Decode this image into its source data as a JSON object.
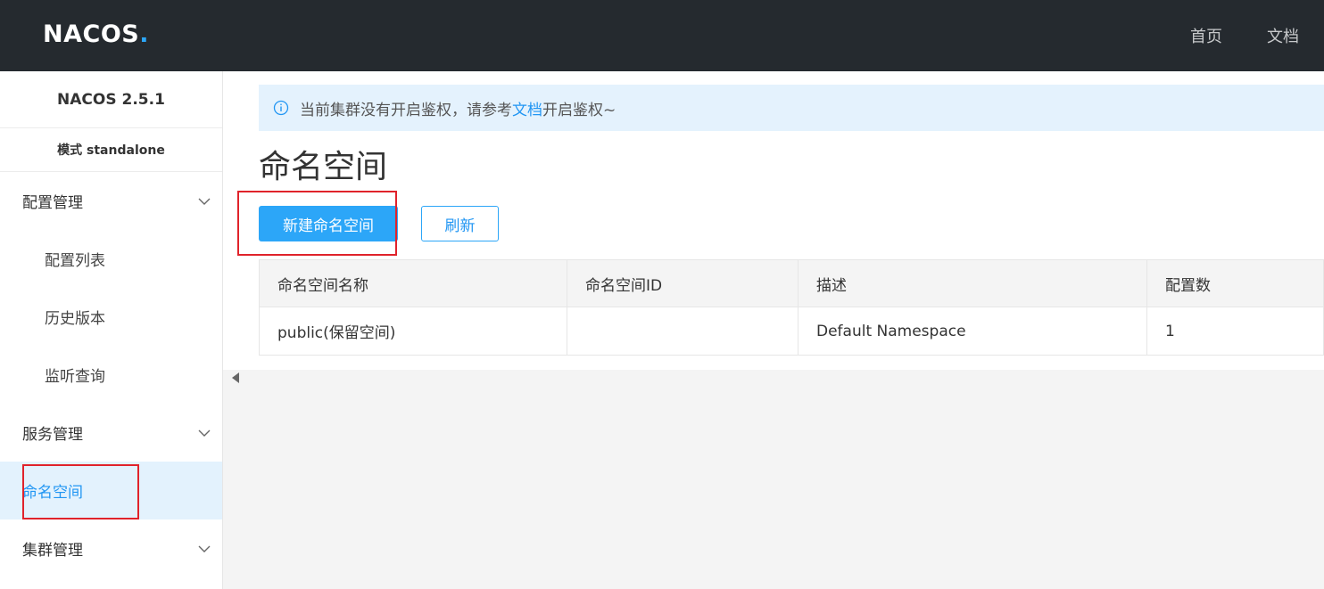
{
  "header": {
    "logo": "NACOS.",
    "nav": [
      "首页",
      "文档"
    ]
  },
  "sidebar": {
    "version": "NACOS 2.5.1",
    "mode": "模式 standalone",
    "groups": [
      {
        "label": "配置管理",
        "items": [
          "配置列表",
          "历史版本",
          "监听查询"
        ]
      },
      {
        "label": "服务管理"
      },
      {
        "label": "命名空间",
        "active": true
      },
      {
        "label": "集群管理"
      }
    ]
  },
  "notice": {
    "prefix": "当前集群没有开启鉴权，请参考",
    "link": "文档",
    "suffix": "开启鉴权~"
  },
  "page": {
    "title": "命名空间",
    "create_button": "新建命名空间",
    "refresh_button": "刷新"
  },
  "table": {
    "headers": [
      "命名空间名称",
      "命名空间ID",
      "描述",
      "配置数"
    ],
    "rows": [
      [
        "public(保留空间)",
        "",
        "Default Namespace",
        "1"
      ]
    ]
  },
  "colors": {
    "accent": "#2ca6f8",
    "header_bg": "#252a2f",
    "highlight": "#e0232b"
  }
}
